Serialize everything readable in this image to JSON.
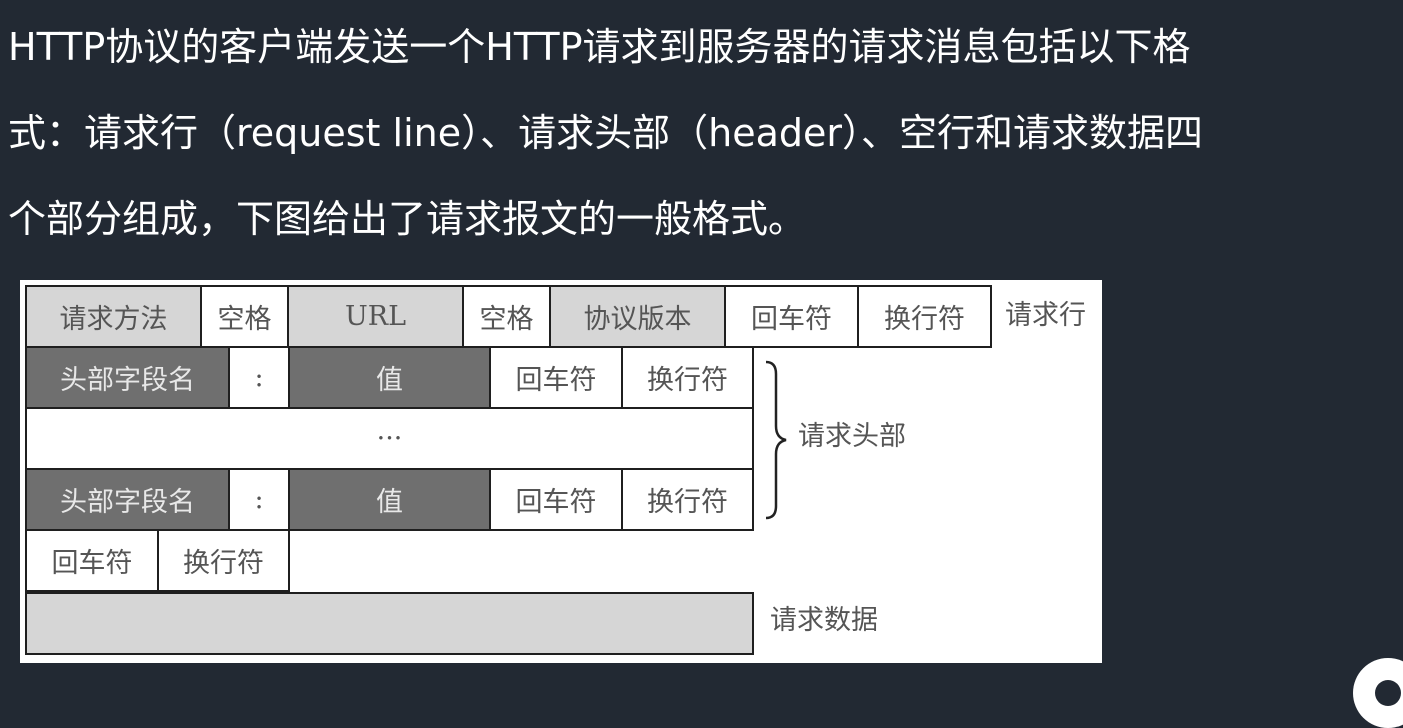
{
  "intro": {
    "line1": "HTTP协议的客户端发送一个HTTP请求到服务器的请求消息包括以下格",
    "line2": "式：请求行（request line）、请求头部（header）、空行和请求数据四",
    "line3": "个部分组成，下图给出了请求报文的一般格式。"
  },
  "request_line": {
    "method": "请求方法",
    "space1": "空格",
    "url": "URL",
    "space2": "空格",
    "version": "协议版本",
    "cr": "回车符",
    "lf": "换行符",
    "label": "请求行"
  },
  "header_row1": {
    "name": "头部字段名",
    "colon": ":",
    "value": "值",
    "cr": "回车符",
    "lf": "换行符"
  },
  "header_ellipsis": "···",
  "header_row2": {
    "name": "头部字段名",
    "colon": ":",
    "value": "值",
    "cr": "回车符",
    "lf": "换行符"
  },
  "header_label": "请求头部",
  "blank_line": {
    "cr": "回车符",
    "lf": "换行符"
  },
  "body_label": "请求数据",
  "colors": {
    "background": "#222933",
    "light_cell": "#d6d6d6",
    "dark_cell": "#6f6f6f"
  }
}
